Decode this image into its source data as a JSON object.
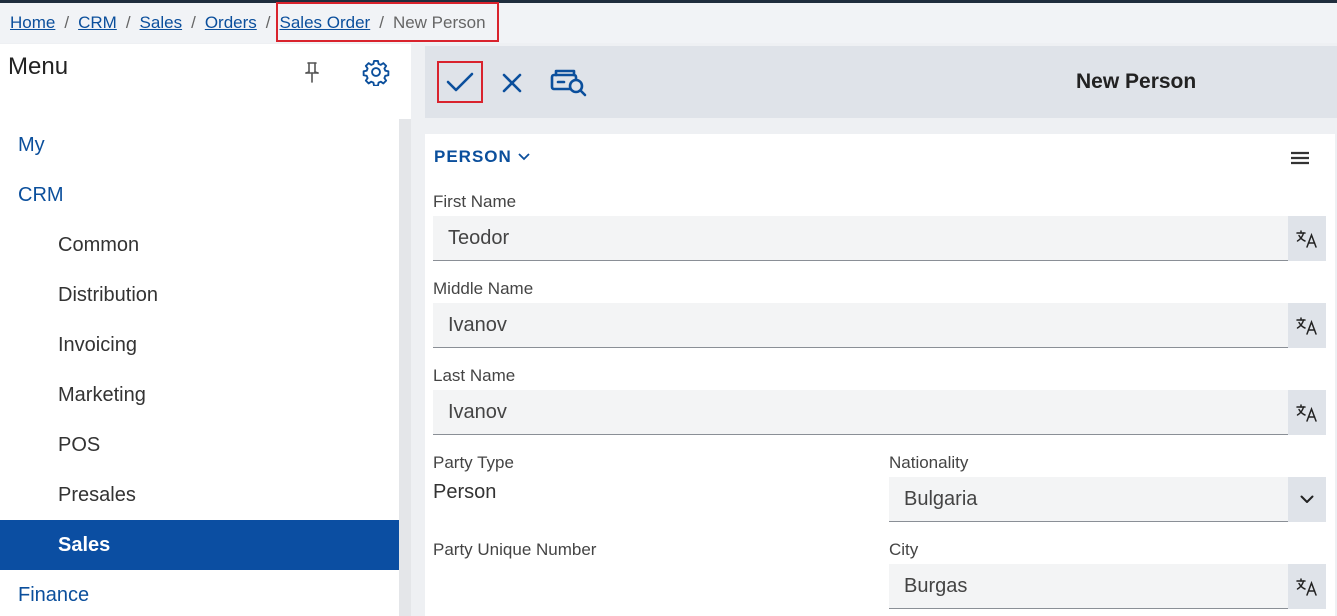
{
  "breadcrumb": {
    "items": [
      "Home",
      "CRM",
      "Sales",
      "Orders",
      "Sales Order"
    ],
    "current": "New Person",
    "separator": "/"
  },
  "sidebar": {
    "title": "Menu",
    "pin_icon": "pin-icon",
    "settings_icon": "gear-icon",
    "items": [
      {
        "label": "My",
        "level": 1
      },
      {
        "label": "CRM",
        "level": 1
      },
      {
        "label": "Common",
        "level": 2
      },
      {
        "label": "Distribution",
        "level": 2
      },
      {
        "label": "Invoicing",
        "level": 2
      },
      {
        "label": "Marketing",
        "level": 2
      },
      {
        "label": "POS",
        "level": 2
      },
      {
        "label": "Presales",
        "level": 2
      },
      {
        "label": "Sales",
        "level": 2,
        "active": true
      },
      {
        "label": "Finance",
        "level": 1
      }
    ]
  },
  "toolbar": {
    "title": "New Person",
    "icons": [
      "checkmark-icon",
      "close-icon",
      "record-search-icon"
    ]
  },
  "form": {
    "section": "PERSON",
    "fields": {
      "first_name": {
        "label": "First Name",
        "value": "Teodor"
      },
      "middle_name": {
        "label": "Middle Name",
        "value": "Ivanov"
      },
      "last_name": {
        "label": "Last Name",
        "value": "Ivanov"
      },
      "party_type": {
        "label": "Party Type",
        "value": "Person"
      },
      "nationality": {
        "label": "Nationality",
        "value": "Bulgaria"
      },
      "party_unique_number": {
        "label": "Party Unique Number",
        "value": ""
      },
      "city": {
        "label": "City",
        "value": "Burgas"
      }
    }
  },
  "colors": {
    "accent": "#0b4f9c",
    "active_nav": "#0b4ea2",
    "highlight": "#d9232d"
  }
}
